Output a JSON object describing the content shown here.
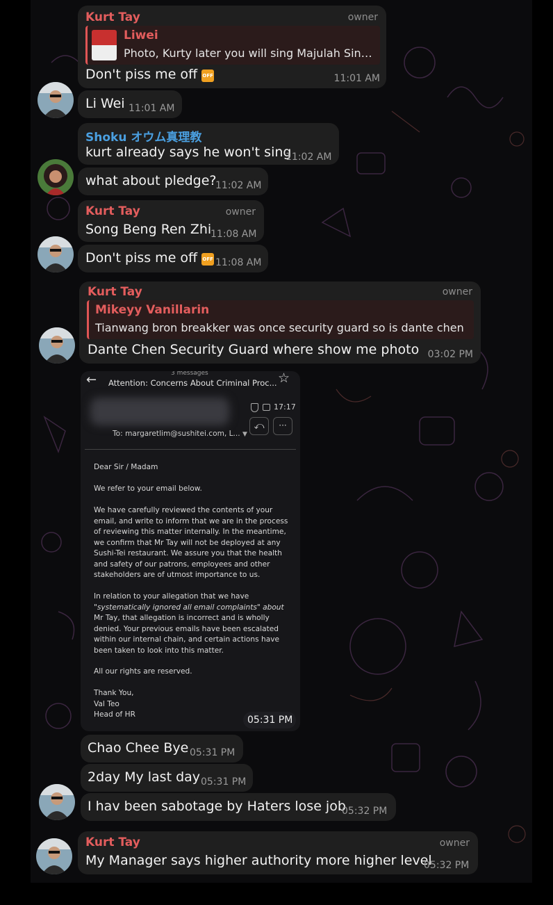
{
  "messages": {
    "m1": {
      "sender": "Kurt Tay",
      "role": "owner",
      "quote_name": "Liwei",
      "quote_text": "Photo, Kurty later you will sing Majulah Sin…",
      "text": "Don't piss me off",
      "icon": "off-icon",
      "time": "11:01 AM"
    },
    "m2": {
      "text": "Li Wei",
      "time": "11:01 AM"
    },
    "m3": {
      "sender": "Shoku オウム真理教",
      "text": "kurt already says he won't sing",
      "time": "11:02 AM"
    },
    "m4": {
      "text": "what about pledge?",
      "time": "11:02 AM"
    },
    "m5": {
      "sender": "Kurt Tay",
      "role": "owner",
      "text": "Song Beng Ren Zhi",
      "time": "11:08 AM"
    },
    "m6": {
      "text": "Don't piss me off",
      "icon": "off-icon",
      "time": "11:08 AM"
    },
    "m7": {
      "sender": "Kurt Tay",
      "role": "owner",
      "quote_name": "Mikeyy Vanillarin",
      "quote_text": "Tianwang bron breakker was once security guard so is dante chen",
      "text": "Dante Chen Security Guard where show me photo",
      "time": "03:02 PM"
    },
    "m8": {
      "time": "05:31 PM"
    },
    "m9": {
      "text": "Chao Chee Bye",
      "time": "05:31 PM"
    },
    "m10": {
      "text": "2day My last day",
      "time": "05:31 PM"
    },
    "m11": {
      "text": "I hav been sabotage by Haters lose job",
      "time": "05:32 PM"
    },
    "m12": {
      "sender": "Kurt Tay",
      "role": "owner",
      "text": "My Manager says higher authority more higher level",
      "time": "05:32 PM"
    }
  },
  "email": {
    "count": "3 messages",
    "subject": "Attention: Concerns About Criminal Proc...",
    "clock": "17:17",
    "to": "To: margaretlim@sushitei.com, L...",
    "lines": [
      "Dear Sir / Madam",
      "We refer to your email below.",
      "We have carefully reviewed the contents of your",
      "email, and write to inform that we are in the process",
      "of reviewing this matter internally. In the meantime,",
      "we confirm that Mr Tay will not be deployed at any",
      "Sushi-Tei restaurant. We assure you that the health",
      "and safety of our patrons, employees and other",
      "stakeholders are of utmost importance to us.",
      "In relation to your allegation that we have",
      "\"systematically ignored all email complaints\" about",
      "Mr Tay, that allegation is incorrect and is wholly",
      "denied. Your previous emails have been escalated",
      "within our internal chain, and certain actions have",
      "been taken to look into this matter.",
      "All our rights are reserved.",
      "Thank You,",
      "Val Teo",
      "Head of HR"
    ]
  },
  "colors": {
    "kurt": "#e35d5d",
    "shoku": "#4a9fe0",
    "bubble": "#1f1f1f",
    "background": "#0b0b0d"
  }
}
